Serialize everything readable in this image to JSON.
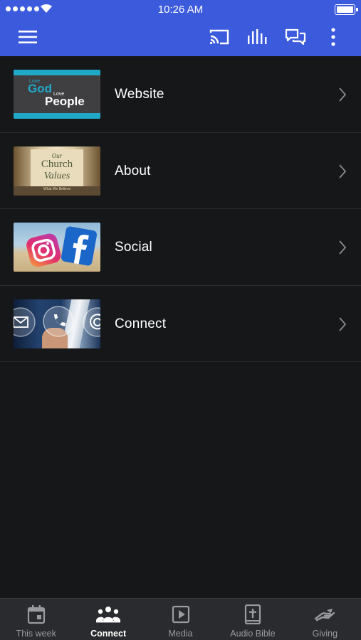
{
  "status_bar": {
    "time": "10:26 AM"
  },
  "header": {
    "menu_icon": "hamburger-menu-icon",
    "actions": [
      "cast-icon",
      "audio-bars-icon",
      "chat-icon",
      "more-vertical-icon"
    ],
    "colors": {
      "header_bg": "#3b5bdc"
    }
  },
  "list": {
    "items": [
      {
        "label": "Website",
        "thumb_text": [
          "Love",
          "God",
          "Love",
          "People"
        ]
      },
      {
        "label": "About",
        "thumb_text": [
          "Our",
          "Church",
          "Values",
          "What We Believe"
        ]
      },
      {
        "label": "Social",
        "thumb_icons": [
          "instagram-logo",
          "facebook-logo"
        ]
      },
      {
        "label": "Connect",
        "thumb_icons": [
          "mail-icon",
          "phone-icon",
          "at-icon"
        ]
      }
    ]
  },
  "tabbar": {
    "tabs": [
      {
        "label": "This week",
        "icon": "calendar-icon",
        "active": false
      },
      {
        "label": "Connect",
        "icon": "people-icon",
        "active": true
      },
      {
        "label": "Media",
        "icon": "play-icon",
        "active": false
      },
      {
        "label": "Audio Bible",
        "icon": "bible-icon",
        "active": false
      },
      {
        "label": "Giving",
        "icon": "giving-hand-icon",
        "active": false
      }
    ]
  }
}
